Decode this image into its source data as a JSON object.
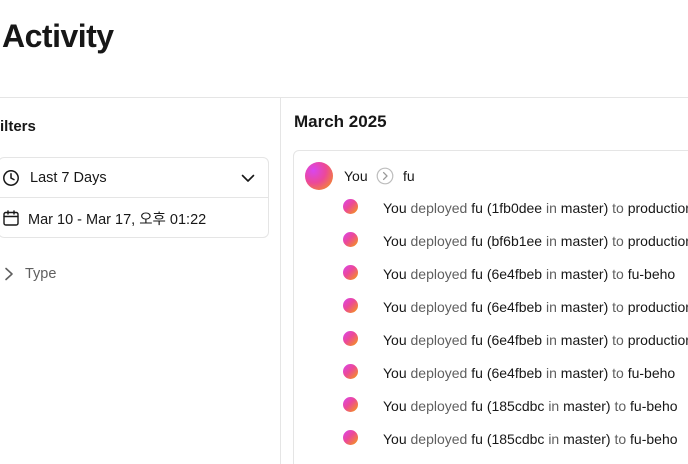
{
  "page": {
    "title": "Activity"
  },
  "sidebar": {
    "heading": "ilters",
    "date_range_preset": "Last 7 Days",
    "date_range_value": "Mar 10 - Mar 17, 오후 01:22",
    "type_filter_label": "Type"
  },
  "feed": {
    "month": "March 2025",
    "group": {
      "user": "You",
      "project": "fu"
    },
    "events": [
      {
        "actor": "You",
        "action": "deployed",
        "project": "fu",
        "open": "(",
        "commit": "1fb0dee",
        "in_word": "in",
        "branch": "master)",
        "to_word": "to",
        "target": "production"
      },
      {
        "actor": "You",
        "action": "deployed",
        "project": "fu",
        "open": "(",
        "commit": "bf6b1ee",
        "in_word": "in",
        "branch": "master)",
        "to_word": "to",
        "target": "production"
      },
      {
        "actor": "You",
        "action": "deployed",
        "project": "fu",
        "open": "(",
        "commit": "6e4fbeb",
        "in_word": "in",
        "branch": "master)",
        "to_word": "to",
        "target": "fu-beho"
      },
      {
        "actor": "You",
        "action": "deployed",
        "project": "fu",
        "open": "(",
        "commit": "6e4fbeb",
        "in_word": "in",
        "branch": "master)",
        "to_word": "to",
        "target": "production"
      },
      {
        "actor": "You",
        "action": "deployed",
        "project": "fu",
        "open": "(",
        "commit": "6e4fbeb",
        "in_word": "in",
        "branch": "master)",
        "to_word": "to",
        "target": "production"
      },
      {
        "actor": "You",
        "action": "deployed",
        "project": "fu",
        "open": "(",
        "commit": "6e4fbeb",
        "in_word": "in",
        "branch": "master)",
        "to_word": "to",
        "target": "fu-beho"
      },
      {
        "actor": "You",
        "action": "deployed",
        "project": "fu",
        "open": "(",
        "commit": "185cdbc",
        "in_word": "in",
        "branch": "master)",
        "to_word": "to",
        "target": "fu-beho"
      },
      {
        "actor": "You",
        "action": "deployed",
        "project": "fu",
        "open": "(",
        "commit": "185cdbc",
        "in_word": "in",
        "branch": "master)",
        "to_word": "to",
        "target": "fu-beho"
      }
    ]
  },
  "icons": {
    "date_preset": "clock-icon",
    "dropdown": "chevron-down-icon",
    "date_value": "calendar-icon",
    "type_expand": "chevron-right-icon",
    "group_arrow": "chevron-right-circle-icon"
  },
  "colors": {
    "avatar_gradient_start": "#d946ef",
    "avatar_gradient_mid": "#ec4899",
    "avatar_gradient_end": "#f59e0b",
    "border": "#e5e5e5",
    "muted_text": "#5f5f5f"
  }
}
